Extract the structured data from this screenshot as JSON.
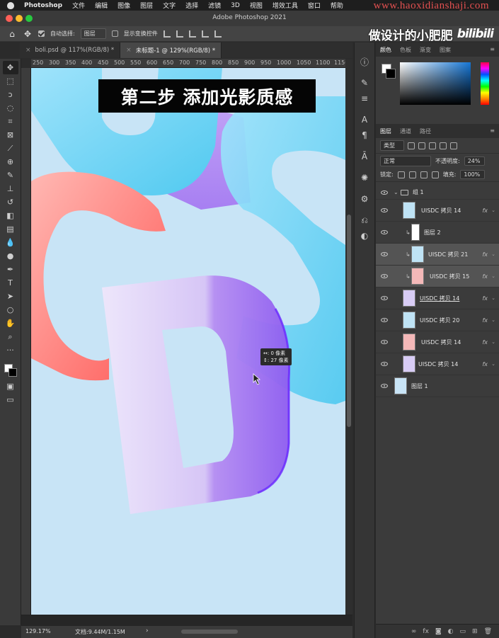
{
  "menubar": {
    "app": "Photoshop",
    "items": [
      "文件",
      "编辑",
      "图像",
      "图层",
      "文字",
      "选择",
      "滤镜",
      "3D",
      "视图",
      "增效工具",
      "窗口",
      "帮助"
    ],
    "watermark": "www.haoxidianshaji.com"
  },
  "window": {
    "title": "Adobe Photoshop 2021"
  },
  "options": {
    "auto_select_label": "自动选择:",
    "auto_select_target": "图层",
    "show_transform_label": "显示变换控件"
  },
  "brand": {
    "cn": "做设计的小肥肥",
    "bili": "bilibili"
  },
  "tabs": [
    {
      "label": "boli.psd @ 117%(RGB/8) *"
    },
    {
      "label": "未标题-1 @ 129%(RGB/8) *"
    }
  ],
  "ruler_ticks": [
    "250",
    "300",
    "350",
    "400",
    "450",
    "500",
    "550",
    "600",
    "650",
    "700",
    "750",
    "800",
    "850",
    "900",
    "950",
    "1000",
    "1050",
    "1100",
    "1150"
  ],
  "canvas": {
    "caption": "第二步 添加光影质感",
    "measure_w": "↔: 0 像素",
    "measure_h": "↕: 27 像素"
  },
  "status": {
    "zoom": "129.17%",
    "doc": "文档:9.44M/1.15M"
  },
  "color_panel": {
    "tabs": [
      "颜色",
      "色板",
      "渐变",
      "图案"
    ],
    "active": "颜色"
  },
  "layers_panel": {
    "tabs": [
      "图层",
      "通道",
      "路径"
    ],
    "kind_label": "类型",
    "blend_mode": "正常",
    "opacity_label": "不透明度:",
    "opacity_value": "24%",
    "lock_label": "锁定:",
    "fill_label": "填充:",
    "fill_value": "100%",
    "layers": [
      {
        "name": "组 1",
        "type": "group"
      },
      {
        "name": "UISDC 拷贝 14",
        "type": "layer",
        "fx": "fx",
        "thumb": "#bfe3f5"
      },
      {
        "name": "图层 2",
        "type": "clip",
        "thumb": "#ffffff"
      },
      {
        "name": "UISDC 拷贝 21",
        "type": "clip",
        "fx": "fx",
        "thumb": "#bfe3f5",
        "selected": true
      },
      {
        "name": "UISDC 拷贝 15",
        "type": "clip",
        "fx": "fx",
        "thumb": "#f4b8b8",
        "selected": true
      },
      {
        "name": "UISDC 拷贝 14",
        "type": "layer",
        "fx": "fx",
        "thumb": "#d8ccf5",
        "underline": true
      },
      {
        "name": "UISDC 拷贝 20",
        "type": "layer",
        "fx": "fx",
        "thumb": "#bfe3f5"
      },
      {
        "name": "UISDC 拷贝 14",
        "type": "layer",
        "fx": "fx",
        "thumb": "#f4b8b8"
      },
      {
        "name": "UISDC 拷贝 14",
        "type": "layer",
        "fx": "fx",
        "thumb": "#d8ccf5"
      },
      {
        "name": "图层 1",
        "type": "layer",
        "thumb": "#c8e4f6"
      }
    ]
  }
}
